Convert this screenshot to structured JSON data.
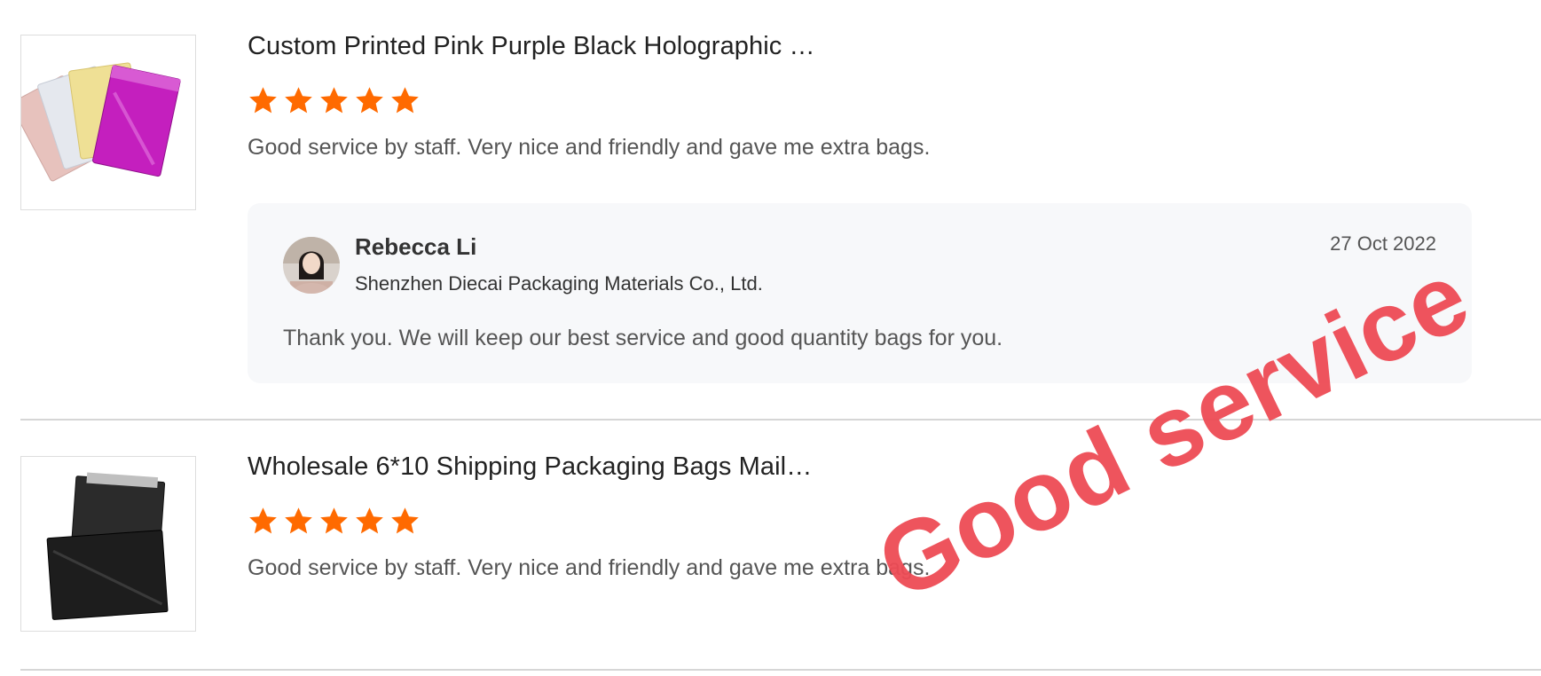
{
  "reviews": [
    {
      "product_title": "Custom Printed Pink Purple Black Holographic …",
      "rating": 5,
      "rating_max": 5,
      "comment": "Good service by staff. Very nice and friendly and gave me extra bags.",
      "thumbnail_icon": "holographic-bubble-mailers-image",
      "reply": {
        "name": "Rebecca Li",
        "company": "Shenzhen Diecai Packaging Materials Co., Ltd.",
        "date": "27 Oct 2022",
        "text": "Thank you. We will keep our best service and good quantity bags for you."
      }
    },
    {
      "product_title": "Wholesale 6*10 Shipping Packaging Bags Mail…",
      "rating": 5,
      "rating_max": 5,
      "comment": "Good service by staff. Very nice and friendly and gave me extra bags.",
      "thumbnail_icon": "black-bubble-mailers-image"
    }
  ],
  "watermark": "Good service",
  "colors": {
    "star": "#ff6a00",
    "watermark": "#ee4b55",
    "reply_background": "#f7f8fa",
    "divider": "#d6d6d6"
  }
}
